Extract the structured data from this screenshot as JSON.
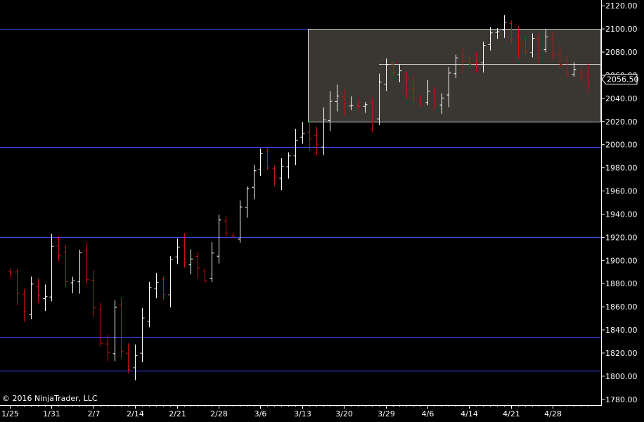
{
  "copyright": "© 2016 NinjaTrader, LLC",
  "colors": {
    "background": "#000000",
    "up_bar": "#ffffff",
    "down_bar": "#cc1111",
    "level_line": "#3a4bff",
    "range_fill": "#3a3632",
    "range_border": "#cfcfcf",
    "axis": "#ffffff"
  },
  "chart_data": {
    "type": "ohlc",
    "x_labels": [
      "1/25",
      "1/31",
      "2/7",
      "2/14",
      "2/21",
      "2/28",
      "3/6",
      "3/13",
      "3/20",
      "3/29",
      "4/6",
      "4/14",
      "4/21",
      "4/28"
    ],
    "x_label_bar_index": [
      0,
      6,
      12,
      18,
      24,
      30,
      36,
      42,
      48,
      54,
      60,
      66,
      72,
      78
    ],
    "bar_count": 84,
    "ylim": [
      1775,
      2125
    ],
    "y_ticks": [
      "2120.00",
      "2100.00",
      "2080.00",
      "2060.00",
      "2040.00",
      "2020.00",
      "2000.00",
      "1980.00",
      "1960.00",
      "1940.00",
      "1920.00",
      "1900.00",
      "1880.00",
      "1860.00",
      "1840.00",
      "1820.00",
      "1800.00",
      "1780.00"
    ],
    "y_tick_values": [
      2120,
      2100,
      2080,
      2060,
      2040,
      2020,
      2000,
      1980,
      1960,
      1940,
      1920,
      1900,
      1880,
      1860,
      1840,
      1820,
      1800,
      1780
    ],
    "last_price_label": "2056.50",
    "last_price": 2056.5,
    "horizontal_levels": [
      2100,
      1998,
      1920,
      1834,
      1805
    ],
    "range_box": {
      "start_bar": 43,
      "end_bar": 84,
      "high": 2100,
      "low": 2020,
      "mid": 2070
    },
    "daily_close": [
      1890,
      1872,
      1855,
      1878,
      1868,
      1872,
      1916,
      1905,
      1885,
      1882,
      1908,
      1886,
      1858,
      1832,
      1825,
      1855,
      1822,
      1808,
      1820,
      1846,
      1876,
      1884,
      1873,
      1900,
      1912,
      1902,
      1906,
      1892,
      1886,
      1906,
      1935,
      1928,
      1918,
      1945,
      1962,
      1978,
      1990,
      1985,
      1975,
      1982,
      1990,
      2002,
      2010,
      2005,
      2000,
      2022,
      2036,
      2042,
      2040,
      2032,
      2036,
      2030,
      2023,
      2056,
      2066,
      2058,
      2064,
      2050,
      2040,
      2036,
      2050,
      2034,
      2038,
      2058,
      2072,
      2076,
      2072,
      2066,
      2088,
      2092,
      2097,
      2102,
      2090,
      2086,
      2081,
      2088,
      2086,
      2090,
      2078,
      2072,
      2060,
      2070,
      2058,
      2055
    ]
  }
}
